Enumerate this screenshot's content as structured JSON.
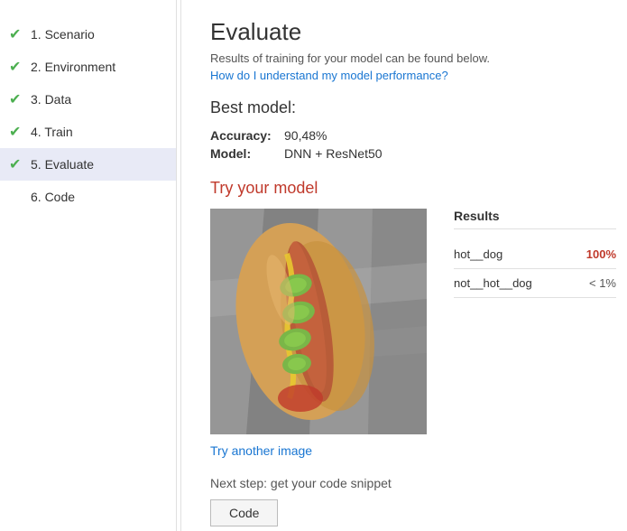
{
  "sidebar": {
    "items": [
      {
        "id": "scenario",
        "label": "1. Scenario",
        "checked": true,
        "active": false
      },
      {
        "id": "environment",
        "label": "2. Environment",
        "checked": true,
        "active": false
      },
      {
        "id": "data",
        "label": "3. Data",
        "checked": true,
        "active": false
      },
      {
        "id": "train",
        "label": "4. Train",
        "checked": true,
        "active": false
      },
      {
        "id": "evaluate",
        "label": "5. Evaluate",
        "checked": true,
        "active": true
      },
      {
        "id": "code",
        "label": "6. Code",
        "checked": false,
        "active": false
      }
    ]
  },
  "main": {
    "page_title": "Evaluate",
    "subtitle": "Results of training for your model can be found below.",
    "help_link_text": "How do I understand my model performance?",
    "best_model_title": "Best model:",
    "accuracy_label": "Accuracy:",
    "accuracy_value": "90,48%",
    "model_label": "Model:",
    "model_value": "DNN + ResNet50",
    "try_model_title": "Try your model",
    "results_title": "Results",
    "results": [
      {
        "label": "hot__dog",
        "value": "100%",
        "high": true
      },
      {
        "label": "not__hot__dog",
        "value": "< 1%",
        "high": false
      }
    ],
    "try_link": "Try another image",
    "next_step_text": "Next step: get your code snippet",
    "code_button_label": "Code"
  }
}
